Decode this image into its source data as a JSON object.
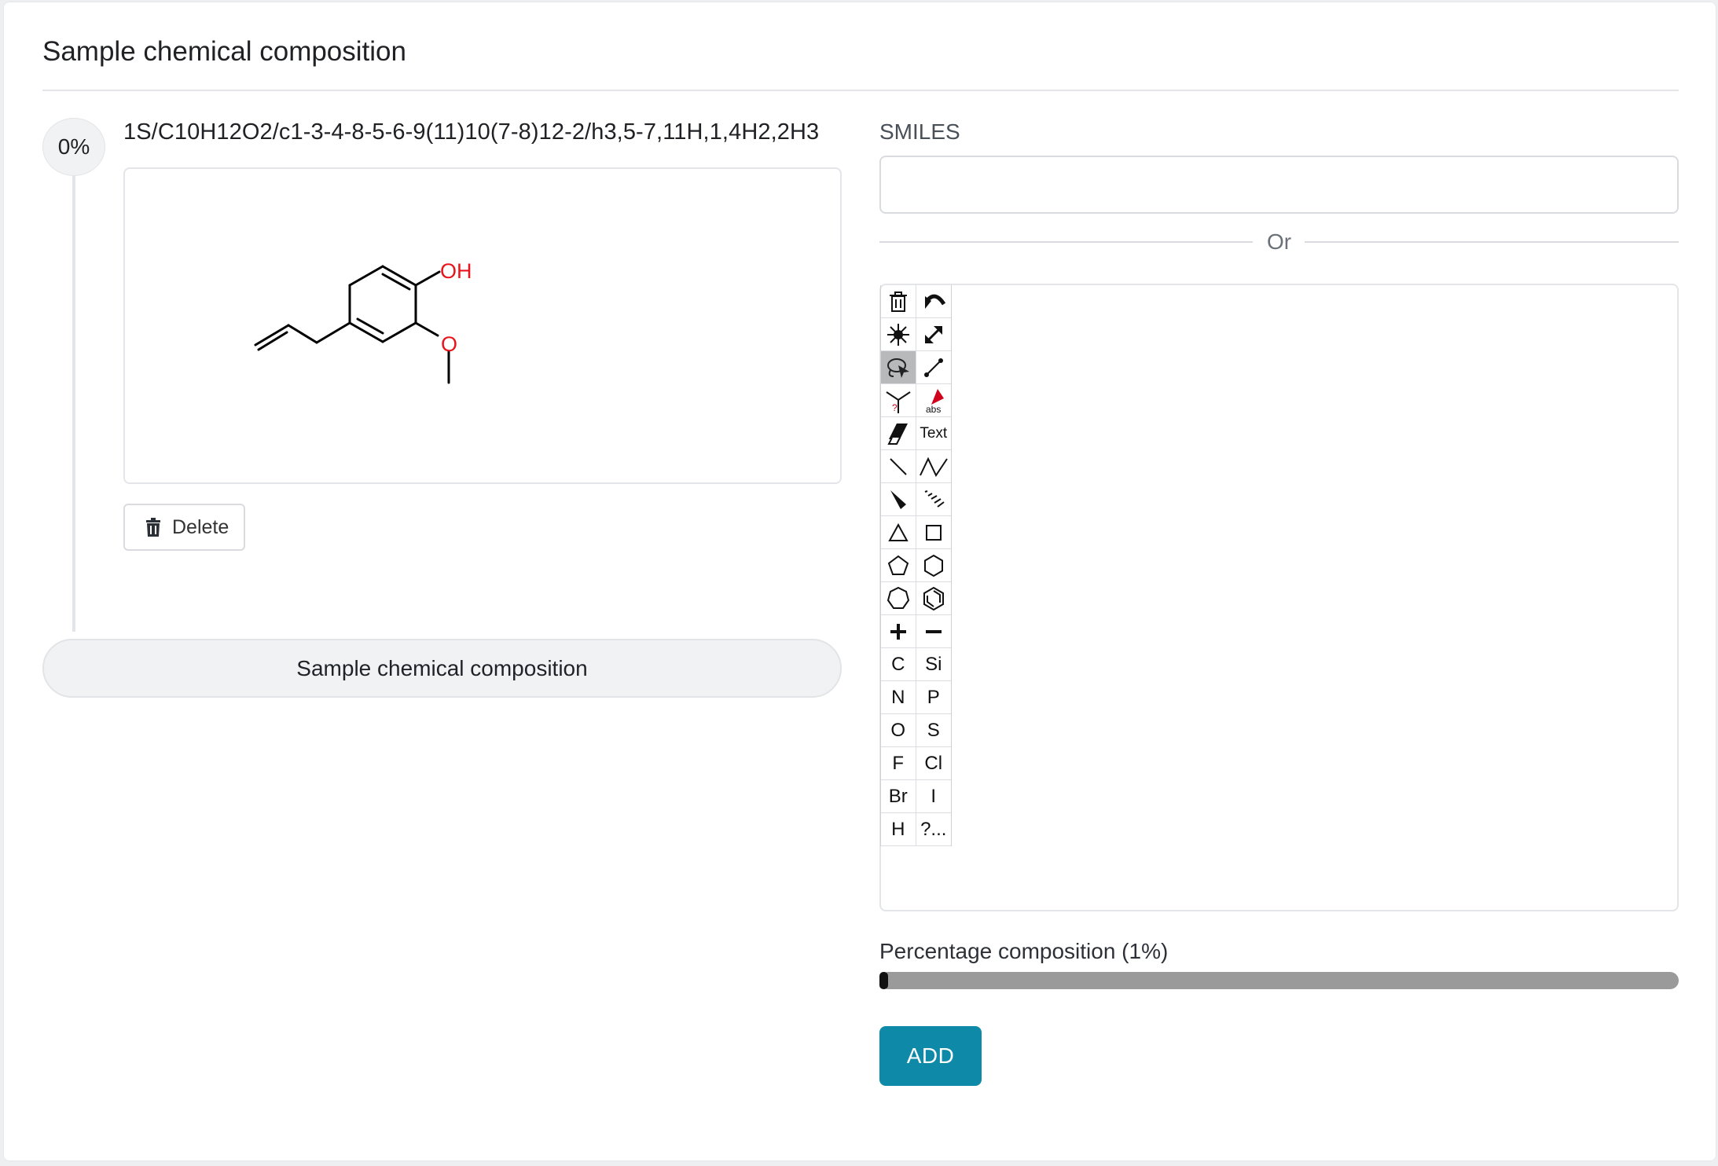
{
  "page": {
    "title": "Sample chemical composition"
  },
  "composition": {
    "percent": "0%",
    "inchi": "1S/C10H12O2/c1-3-4-8-5-6-9(11)10(7-8)12-2/h3,5-7,11H,1,4H2,2H3",
    "atom_labels": {
      "oh": "OH",
      "o": "O"
    },
    "delete_label": "Delete",
    "sample_button_label": "Sample chemical composition"
  },
  "smiles": {
    "label": "SMILES",
    "value": "",
    "divider": "Or"
  },
  "editor": {
    "tools": [
      [
        "trash-icon",
        "undo-icon"
      ],
      [
        "center-atom-icon",
        "resize-arrow-icon"
      ],
      [
        "lasso-select-icon",
        "bond-draw-icon"
      ],
      [
        "query-atom-icon",
        "abs-stereo-icon"
      ],
      [
        "eraser-icon",
        "Text"
      ],
      [
        "single-bond-icon",
        "chain-icon"
      ],
      [
        "wedge-bond-icon",
        "hash-bond-icon"
      ],
      [
        "triangle-ring-icon",
        "square-ring-icon"
      ],
      [
        "pentagon-ring-icon",
        "hexagon-ring-icon"
      ],
      [
        "heptagon-ring-icon",
        "benzene-ring-icon"
      ],
      [
        "plus-charge-icon",
        "minus-charge-icon"
      ],
      [
        "C",
        "Si"
      ],
      [
        "N",
        "P"
      ],
      [
        "O",
        "S"
      ],
      [
        "F",
        "Cl"
      ],
      [
        "Br",
        "I"
      ],
      [
        "H",
        "?..."
      ]
    ],
    "abs_label": "abs",
    "text_label": "Text",
    "query_mark": "?",
    "active_tool": "lasso-select-icon",
    "elements": {
      "c": "C",
      "si": "Si",
      "n": "N",
      "p": "P",
      "o": "O",
      "s": "S",
      "f": "F",
      "cl": "Cl",
      "br": "Br",
      "i": "I",
      "h": "H",
      "more": "?..."
    }
  },
  "percentage": {
    "label": "Percentage composition (1%)",
    "value_percent": 1
  },
  "add_label": "ADD",
  "colors": {
    "accent": "#0e8aa8",
    "heteroatom": "#e8141c",
    "slider_track": "#9a9a9a"
  }
}
